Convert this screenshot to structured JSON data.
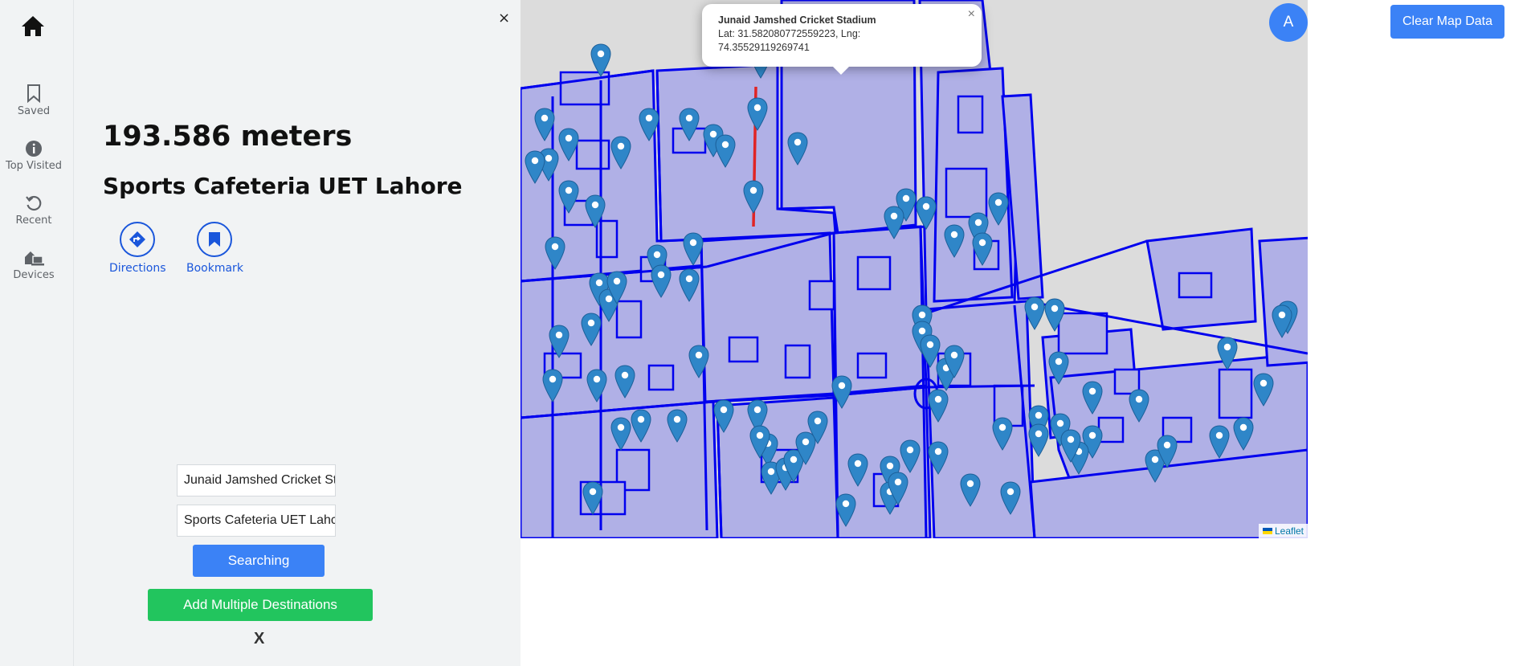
{
  "rail": {
    "items": [
      {
        "label": "Saved",
        "icon": "bookmark-icon"
      },
      {
        "label": "Top Visited",
        "icon": "info-icon"
      },
      {
        "label": "Recent",
        "icon": "history-icon"
      },
      {
        "label": "Devices",
        "icon": "devices-icon"
      }
    ]
  },
  "panel": {
    "close": "×",
    "distance": "193.586 meters",
    "place_name": "Sports Cafeteria UET Lahore",
    "actions": {
      "directions": "Directions",
      "bookmark": "Bookmark"
    },
    "origin_value": "Junaid Jamshed Cricket St",
    "destination_value": "Sports Cafeteria UET Lahc",
    "search_button": "Searching",
    "multi_button": "Add Multiple Destinations",
    "x_label": "X"
  },
  "map": {
    "popup": {
      "title": "Junaid Jamshed Cricket Stadium",
      "coords_line1": "Lat: 31.582080772559223, Lng:",
      "coords_line2": "74.35529119269741",
      "close": "×"
    },
    "attribution": "Leaflet",
    "route_color": "#e02424",
    "building_fill": "#b0b0e6",
    "outline_color": "#0000ee",
    "marker_color": "#2f86c8"
  },
  "avatar_letter": "A",
  "clear_button": "Clear Map Data"
}
